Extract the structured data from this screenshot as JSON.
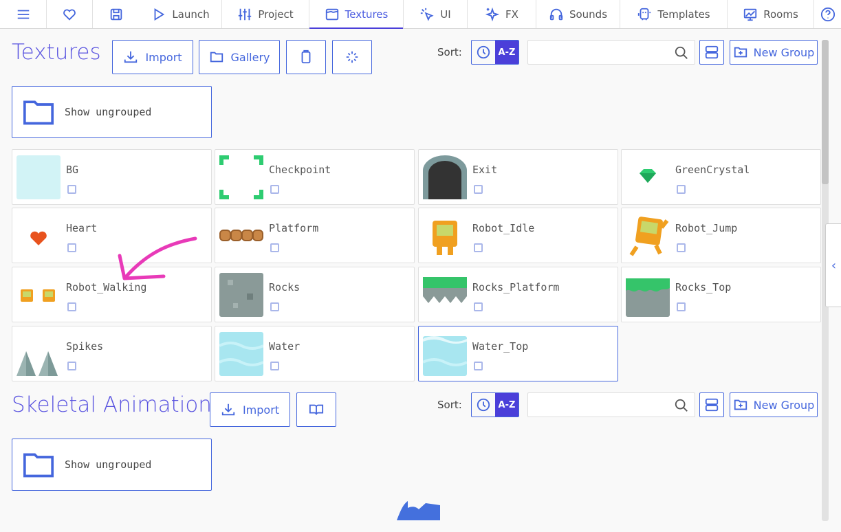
{
  "nav": {
    "tabs": [
      {
        "label": "",
        "icon": "menu-icon"
      },
      {
        "label": "",
        "icon": "heart-icon"
      },
      {
        "label": "",
        "icon": "save-icon"
      },
      {
        "label": "Launch",
        "icon": "play-icon"
      },
      {
        "label": "Project",
        "icon": "sliders-icon"
      },
      {
        "label": "Textures",
        "icon": "texture-icon",
        "active": true
      },
      {
        "label": "UI",
        "icon": "cursor-icon"
      },
      {
        "label": "FX",
        "icon": "sparkles-icon"
      },
      {
        "label": "Sounds",
        "icon": "headphones-icon"
      },
      {
        "label": "Templates",
        "icon": "template-icon"
      },
      {
        "label": "Rooms",
        "icon": "room-icon"
      },
      {
        "label": "",
        "icon": "help-icon"
      }
    ]
  },
  "textures": {
    "title": "Textures",
    "import": "Import",
    "gallery": "Gallery",
    "sort_label": "Sort:",
    "sort_az": "A-Z",
    "search_placeholder": "",
    "new_group": "New Group",
    "show_ungrouped": "Show ungrouped",
    "items": [
      "BG",
      "Checkpoint",
      "Exit",
      "GreenCrystal",
      "Heart",
      "Platform",
      "Robot_Idle",
      "Robot_Jump",
      "Robot_Walking",
      "Rocks",
      "Rocks_Platform",
      "Rocks_Top",
      "Spikes",
      "Water",
      "Water_Top"
    ],
    "selected": "Water_Top"
  },
  "skeletal": {
    "title": "Skeletal Animation",
    "import": "Import",
    "sort_label": "Sort:",
    "sort_az": "A-Z",
    "search_placeholder": "",
    "new_group": "New Group",
    "show_ungrouped": "Show ungrouped"
  },
  "colors": {
    "accent": "#4466dd",
    "active": "#4b3fd9",
    "annotation": "#e83ab8"
  }
}
